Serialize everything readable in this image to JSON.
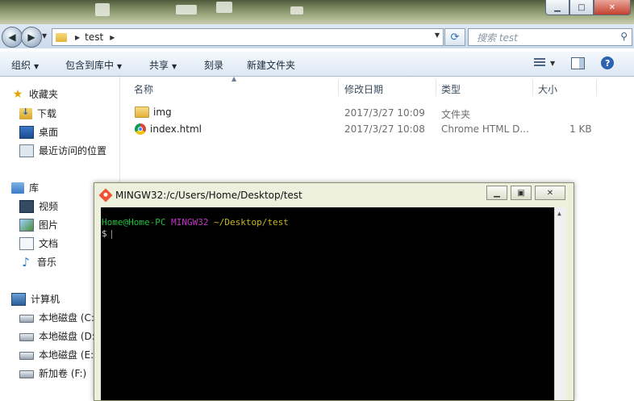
{
  "window": {
    "controls": {
      "minimize": "▁",
      "maximize": "□",
      "close": "✕"
    }
  },
  "nav": {
    "address_crumbs": [
      "test"
    ],
    "search_placeholder": "搜索 test"
  },
  "toolbar": {
    "organize": "组织",
    "include_in_library": "包含到库中",
    "share": "共享",
    "burn": "刻录",
    "new_folder": "新建文件夹"
  },
  "sidebar": {
    "favorites": {
      "label": "收藏夹",
      "items": [
        "下载",
        "桌面",
        "最近访问的位置"
      ]
    },
    "libraries": {
      "label": "库",
      "items": [
        "视频",
        "图片",
        "文档",
        "音乐"
      ]
    },
    "computer": {
      "label": "计算机",
      "items": [
        "本地磁盘 (C:)",
        "本地磁盘 (D:)",
        "本地磁盘 (E:)",
        "新加卷 (F:)"
      ]
    }
  },
  "filelist": {
    "columns": {
      "name": "名称",
      "modified": "修改日期",
      "type": "类型",
      "size": "大小"
    },
    "rows": [
      {
        "name": "img",
        "icon": "folder-icon",
        "modified": "2017/3/27 10:09",
        "type": "文件夹",
        "size": ""
      },
      {
        "name": "index.html",
        "icon": "chrome-icon",
        "modified": "2017/3/27 10:08",
        "type": "Chrome HTML D...",
        "size": "1 KB"
      }
    ]
  },
  "terminal": {
    "title": "MINGW32:/c/Users/Home/Desktop/test",
    "prompt_user": "Home@Home-PC",
    "prompt_env": "MINGW32",
    "prompt_path": "~/Desktop/test",
    "prompt_symbol": "$",
    "colors": {
      "user": "#1fc23f",
      "env": "#c336c8",
      "path": "#c9b71e"
    }
  }
}
